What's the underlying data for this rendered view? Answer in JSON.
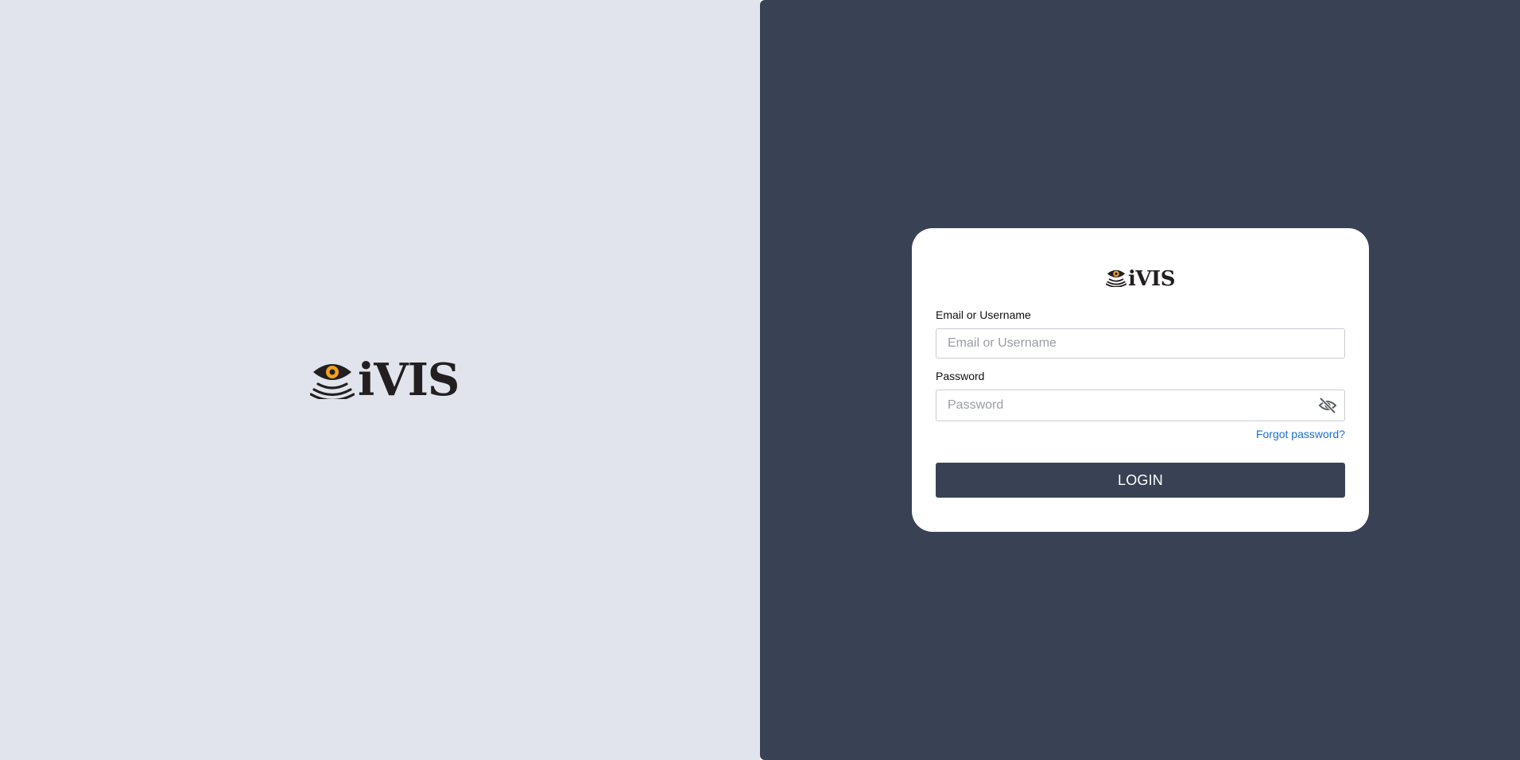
{
  "brand": {
    "name": "iVIS",
    "icon": "eye-signal-icon",
    "colors": {
      "dark": "#231f20",
      "accent": "#f2a21b"
    }
  },
  "theme": {
    "left_background": "#e1e4ed",
    "right_background": "#394254",
    "card_background": "#ffffff",
    "link_color": "#1a6fd6"
  },
  "login_form": {
    "username": {
      "label": "Email or Username",
      "placeholder": "Email or Username",
      "value": ""
    },
    "password": {
      "label": "Password",
      "placeholder": "Password",
      "value": "",
      "toggle_icon": "eye-off-icon"
    },
    "forgot_password": "Forgot password?",
    "submit_label": "LOGIN"
  }
}
